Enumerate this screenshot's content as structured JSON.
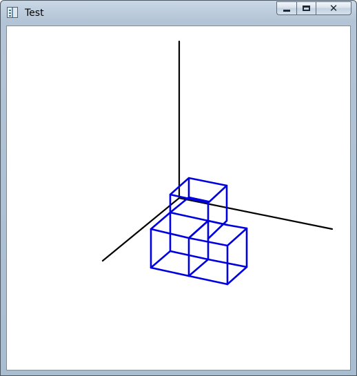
{
  "window": {
    "title": "Test",
    "icon": "app-window-icon",
    "buttons": {
      "minimize": "minimize-icon",
      "maximize": "maximize-icon",
      "close": "close-icon",
      "close_glyph": "✕"
    }
  },
  "scene": {
    "axis_color": "#000000",
    "cube_color": "#0000dd",
    "background": "#ffffff"
  }
}
